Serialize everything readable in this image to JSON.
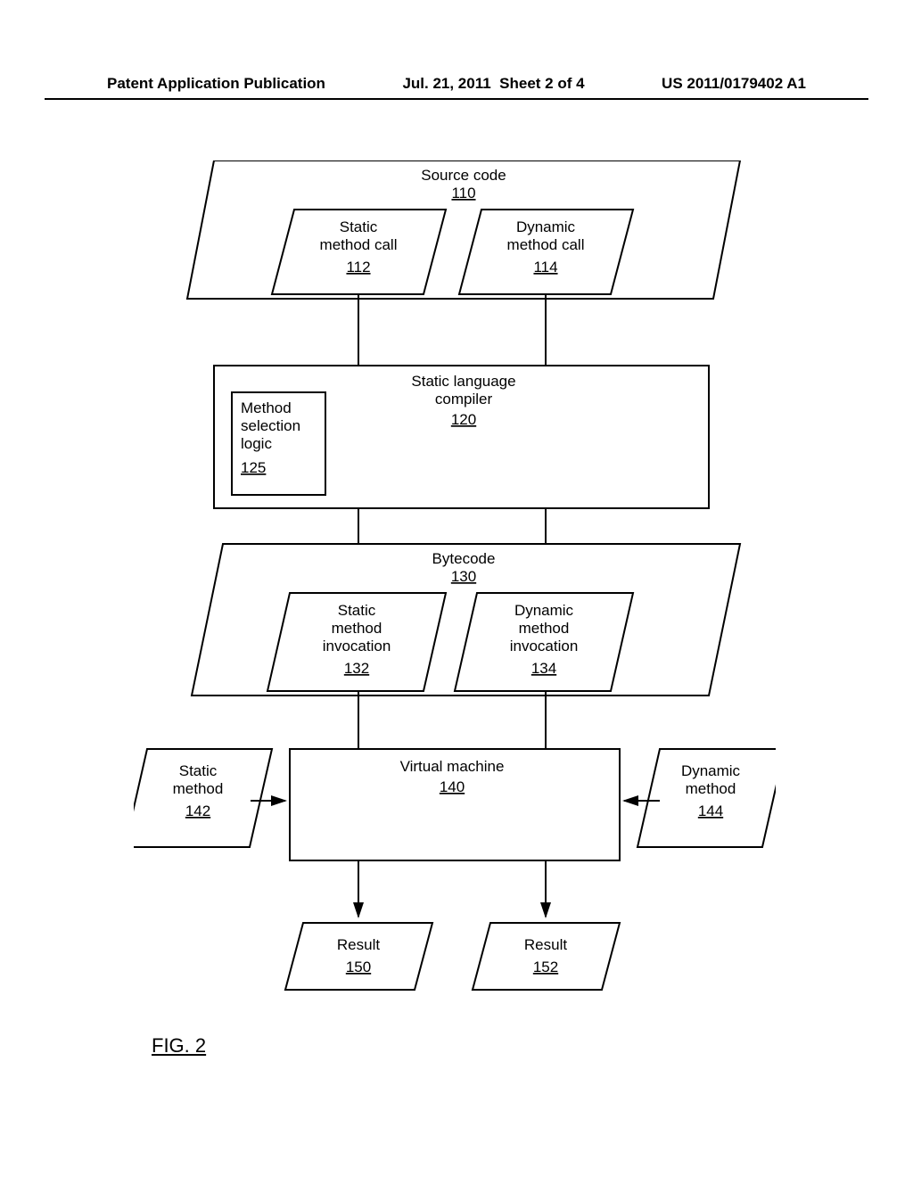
{
  "header": {
    "left": "Patent Application Publication",
    "center_date": "Jul. 21, 2011",
    "center_sheet": "Sheet 2 of 4",
    "right": "US 2011/0179402 A1"
  },
  "figure_label": "FIG. 2",
  "blocks": {
    "source_code": {
      "title": "Source code",
      "ref": "110"
    },
    "static_call": {
      "l1": "Static",
      "l2": "method call",
      "ref": "112"
    },
    "dynamic_call": {
      "l1": "Dynamic",
      "l2": "method call",
      "ref": "114"
    },
    "compiler": {
      "l1": "Static language",
      "l2": "compiler",
      "ref": "120"
    },
    "method_sel": {
      "l1": "Method",
      "l2": "selection",
      "l3": "logic",
      "ref": "125"
    },
    "bytecode": {
      "title": "Bytecode",
      "ref": "130"
    },
    "static_inv": {
      "l1": "Static",
      "l2": "method",
      "l3": "invocation",
      "ref": "132"
    },
    "dynamic_inv": {
      "l1": "Dynamic",
      "l2": "method",
      "l3": "invocation",
      "ref": "134"
    },
    "vm": {
      "title": "Virtual machine",
      "ref": "140"
    },
    "static_method": {
      "l1": "Static",
      "l2": "method",
      "ref": "142"
    },
    "dynamic_method": {
      "l1": "Dynamic",
      "l2": "method",
      "ref": "144"
    },
    "result_l": {
      "title": "Result",
      "ref": "150"
    },
    "result_r": {
      "title": "Result",
      "ref": "152"
    }
  }
}
